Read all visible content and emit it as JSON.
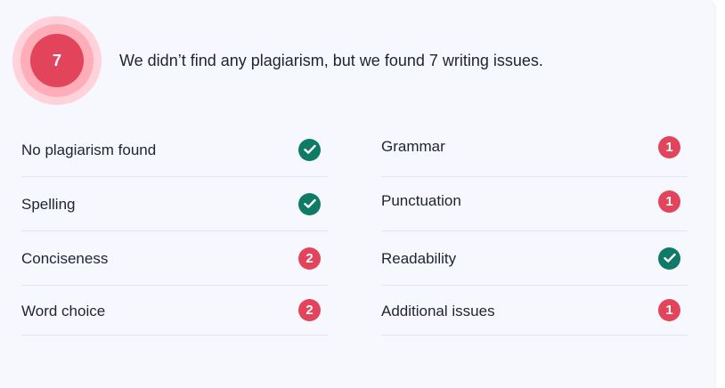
{
  "score": {
    "count": "7"
  },
  "summary": {
    "text": "We didn’t find any plagiarism, but we found 7 writing issues."
  },
  "colors": {
    "ok": "#0f7b66",
    "issue": "#e2445c",
    "ring_outer": "#ffd3d9",
    "ring_mid": "#ffadb8"
  },
  "checks_left": [
    {
      "label": "No plagiarism found",
      "status": "ok",
      "count": ""
    },
    {
      "label": "Spelling",
      "status": "ok",
      "count": ""
    },
    {
      "label": "Conciseness",
      "status": "issue",
      "count": "2"
    },
    {
      "label": "Word choice",
      "status": "issue",
      "count": "2"
    }
  ],
  "checks_right": [
    {
      "label": "Grammar",
      "status": "issue",
      "count": "1"
    },
    {
      "label": "Punctuation",
      "status": "issue",
      "count": "1"
    },
    {
      "label": "Readability",
      "status": "ok",
      "count": ""
    },
    {
      "label": "Additional issues",
      "status": "issue",
      "count": "1"
    }
  ]
}
